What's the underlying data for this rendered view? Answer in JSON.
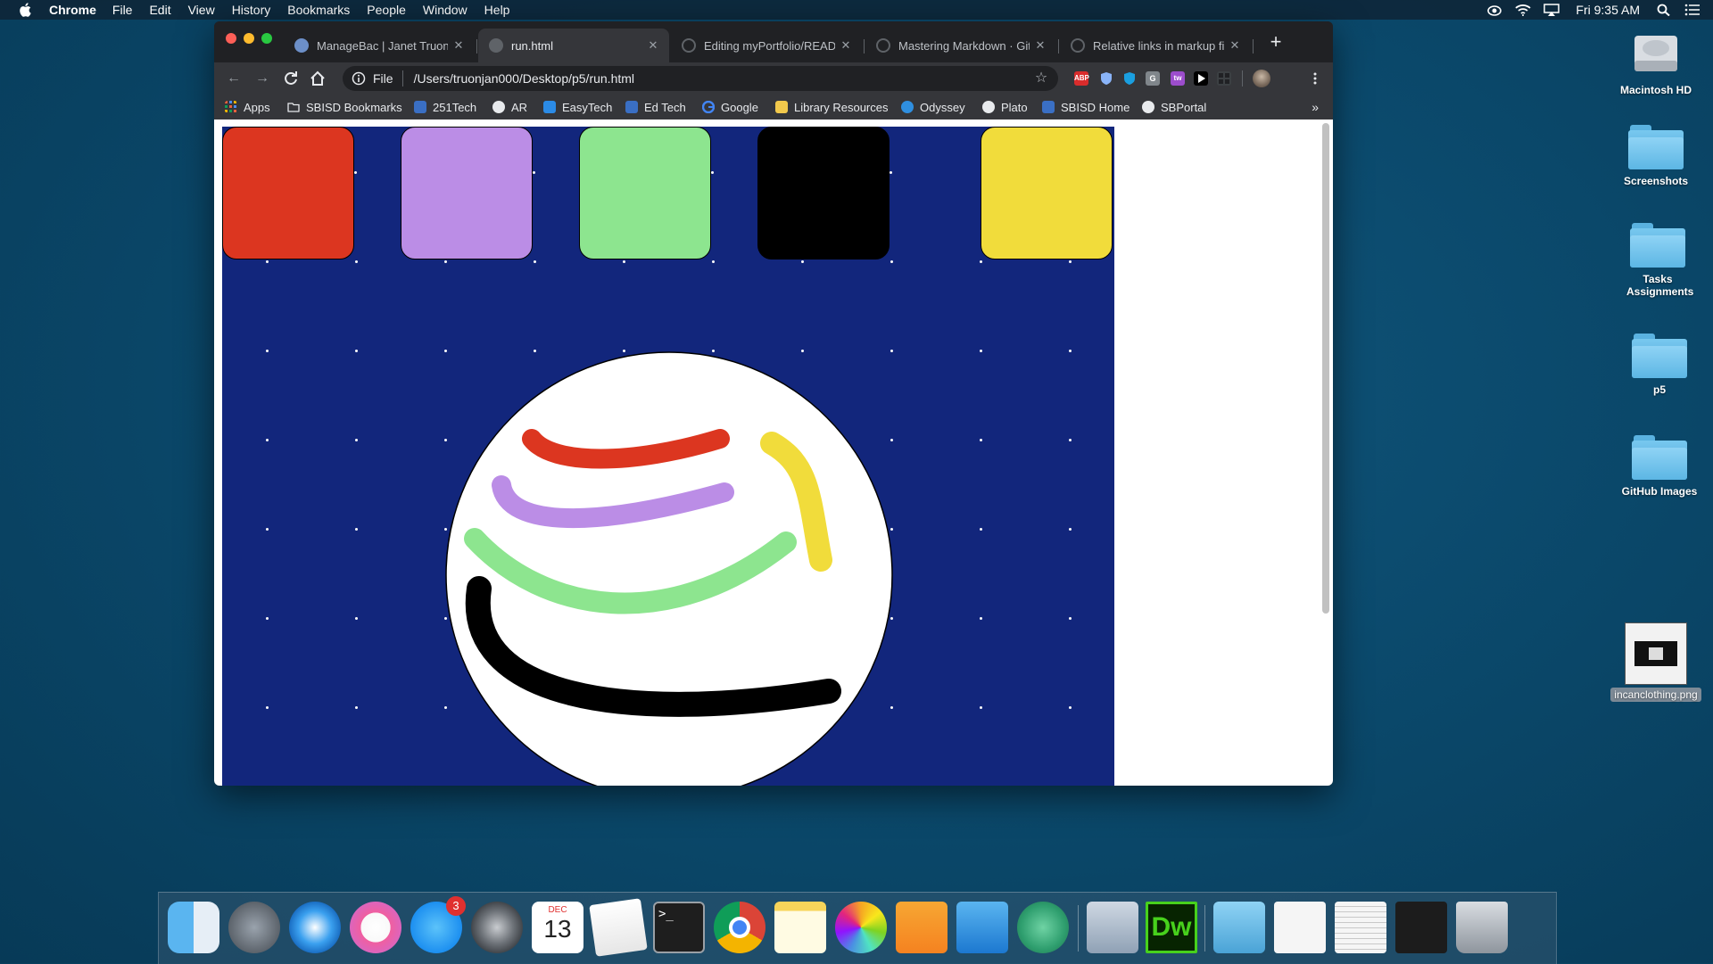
{
  "menubar": {
    "app_name": "Chrome",
    "menus": [
      "File",
      "Edit",
      "View",
      "History",
      "Bookmarks",
      "People",
      "Window",
      "Help"
    ],
    "clock": "Fri 9:35 AM"
  },
  "browser": {
    "tabs": [
      {
        "title": "ManageBac | Janet Truong",
        "active": false
      },
      {
        "title": "run.html",
        "active": true
      },
      {
        "title": "Editing myPortfolio/README",
        "active": false
      },
      {
        "title": "Mastering Markdown · GitHub",
        "active": false
      },
      {
        "title": "Relative links in markup file",
        "active": false
      }
    ],
    "new_tab_label": "+",
    "omnibox": {
      "scheme": "File",
      "url": "/Users/truonjan000/Desktop/p5/run.html"
    },
    "extensions": [
      "ABP",
      "shield",
      "ublock",
      "G",
      "tw",
      "play",
      "grid"
    ],
    "bookmarks": [
      {
        "label": "Apps",
        "icon": "apps-grid-icon"
      },
      {
        "label": "SBISD Bookmarks",
        "icon": "folder-icon"
      },
      {
        "label": "251Tech",
        "icon": "site-icon"
      },
      {
        "label": "AR",
        "icon": "site-icon"
      },
      {
        "label": "EasyTech",
        "icon": "site-icon"
      },
      {
        "label": "Ed Tech",
        "icon": "site-icon"
      },
      {
        "label": "Google",
        "icon": "google-icon"
      },
      {
        "label": "Library Resources",
        "icon": "site-icon"
      },
      {
        "label": "Odyssey",
        "icon": "site-icon"
      },
      {
        "label": "Plato",
        "icon": "site-icon"
      },
      {
        "label": "SBISD Home",
        "icon": "site-icon"
      },
      {
        "label": "SBPortal",
        "icon": "site-icon"
      }
    ],
    "bookmarks_more": "»"
  },
  "sketch": {
    "background": "#12267c",
    "palette": [
      "#dc3620",
      "#bb8de6",
      "#8de58f",
      "#000000",
      "#f1dc3b"
    ],
    "strokes": [
      {
        "color": "#dc3620",
        "label": "red stroke"
      },
      {
        "color": "#bb8de6",
        "label": "purple stroke"
      },
      {
        "color": "#8de58f",
        "label": "green stroke"
      },
      {
        "color": "#000000",
        "label": "black stroke"
      },
      {
        "color": "#f1dc3b",
        "label": "yellow stroke"
      }
    ]
  },
  "desktop": {
    "icons": [
      {
        "label": "Macintosh HD",
        "type": "drive"
      },
      {
        "label": "Screenshots",
        "type": "folder"
      },
      {
        "label": "Tasks Assignments",
        "type": "folder"
      },
      {
        "label": "p5",
        "type": "folder"
      },
      {
        "label": "GitHub Images",
        "type": "folder"
      },
      {
        "label": "incanclothing.png",
        "type": "image"
      }
    ]
  },
  "dock": {
    "apps": [
      "Finder",
      "Launchpad",
      "Safari",
      "iTunes",
      "App Store",
      "System Preferences",
      "Calendar",
      "TextEdit",
      "Terminal",
      "Chrome",
      "Notes",
      "Photos",
      "Pages",
      "Keynote",
      "Atom",
      "Preview",
      "Dreamweaver",
      "Applications",
      "Documents",
      "Downloads",
      "Screen",
      "Trash"
    ],
    "app_store_badge": "3",
    "calendar_month": "DEC",
    "calendar_day": "13",
    "dreamweaver_label": "Dw"
  }
}
